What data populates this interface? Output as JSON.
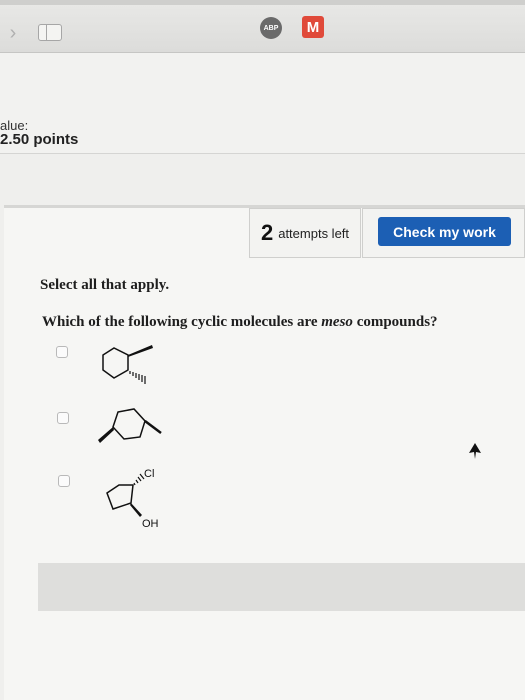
{
  "browser": {
    "forward_glyph": "›",
    "extension_abp": "ABP",
    "extension_gmail": "M"
  },
  "assignment": {
    "value_label": "alue:",
    "points_label": "2.50 points"
  },
  "toolbar": {
    "attempts_count": "2",
    "attempts_text": "attempts left",
    "check_label": "Check my work"
  },
  "question": {
    "instructions": "Select all that apply.",
    "prompt_prefix": "Which of the following cyclic molecules are ",
    "prompt_emphasis": "meso",
    "prompt_suffix": " compounds?",
    "options": [
      {
        "id": "option-1",
        "structure": "cyclohexane with one wedge bond and one hashed methyl",
        "labels": []
      },
      {
        "id": "option-2",
        "structure": "cyclohexane with two substituent bonds",
        "labels": []
      },
      {
        "id": "option-3",
        "structure": "cyclopentane with Cl and OH substituents",
        "labels": [
          "Cl",
          "OH"
        ]
      }
    ]
  },
  "colors": {
    "accent": "#1c5fb4",
    "page_bg": "#efefed",
    "panel_bg": "#f6f6f4"
  }
}
